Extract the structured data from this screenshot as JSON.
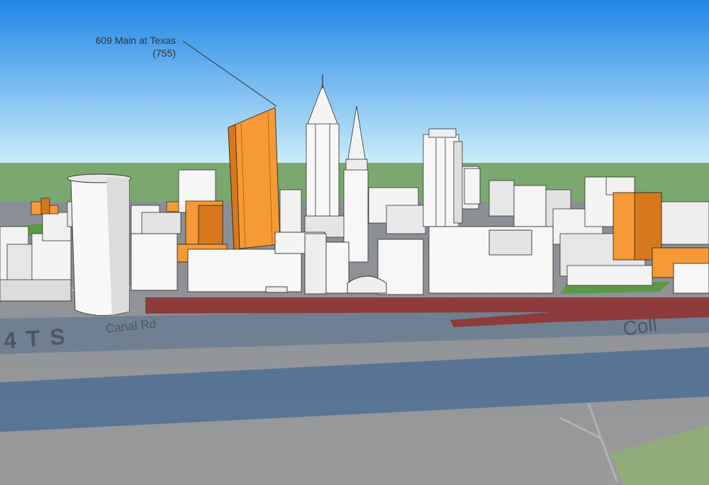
{
  "callout": {
    "title": "609 Main at Texas",
    "height": "(755)"
  },
  "map_labels": {
    "street": "Canal Rd",
    "highway": "4TS",
    "right_road": "Coll"
  },
  "colors": {
    "sky_top": "#1f86e6",
    "sky_bottom": "#cfeffa",
    "horizon_green": "#7aa86e",
    "building_white": "#f4f4f4",
    "building_shade": "#d8d8d8",
    "highlight_orange": "#f59a36",
    "highlight_orange_dark": "#d8781c",
    "road_red": "#8e3b3b",
    "bayou_blue": "#4d6e94",
    "ground_gray": "#8f9296"
  }
}
